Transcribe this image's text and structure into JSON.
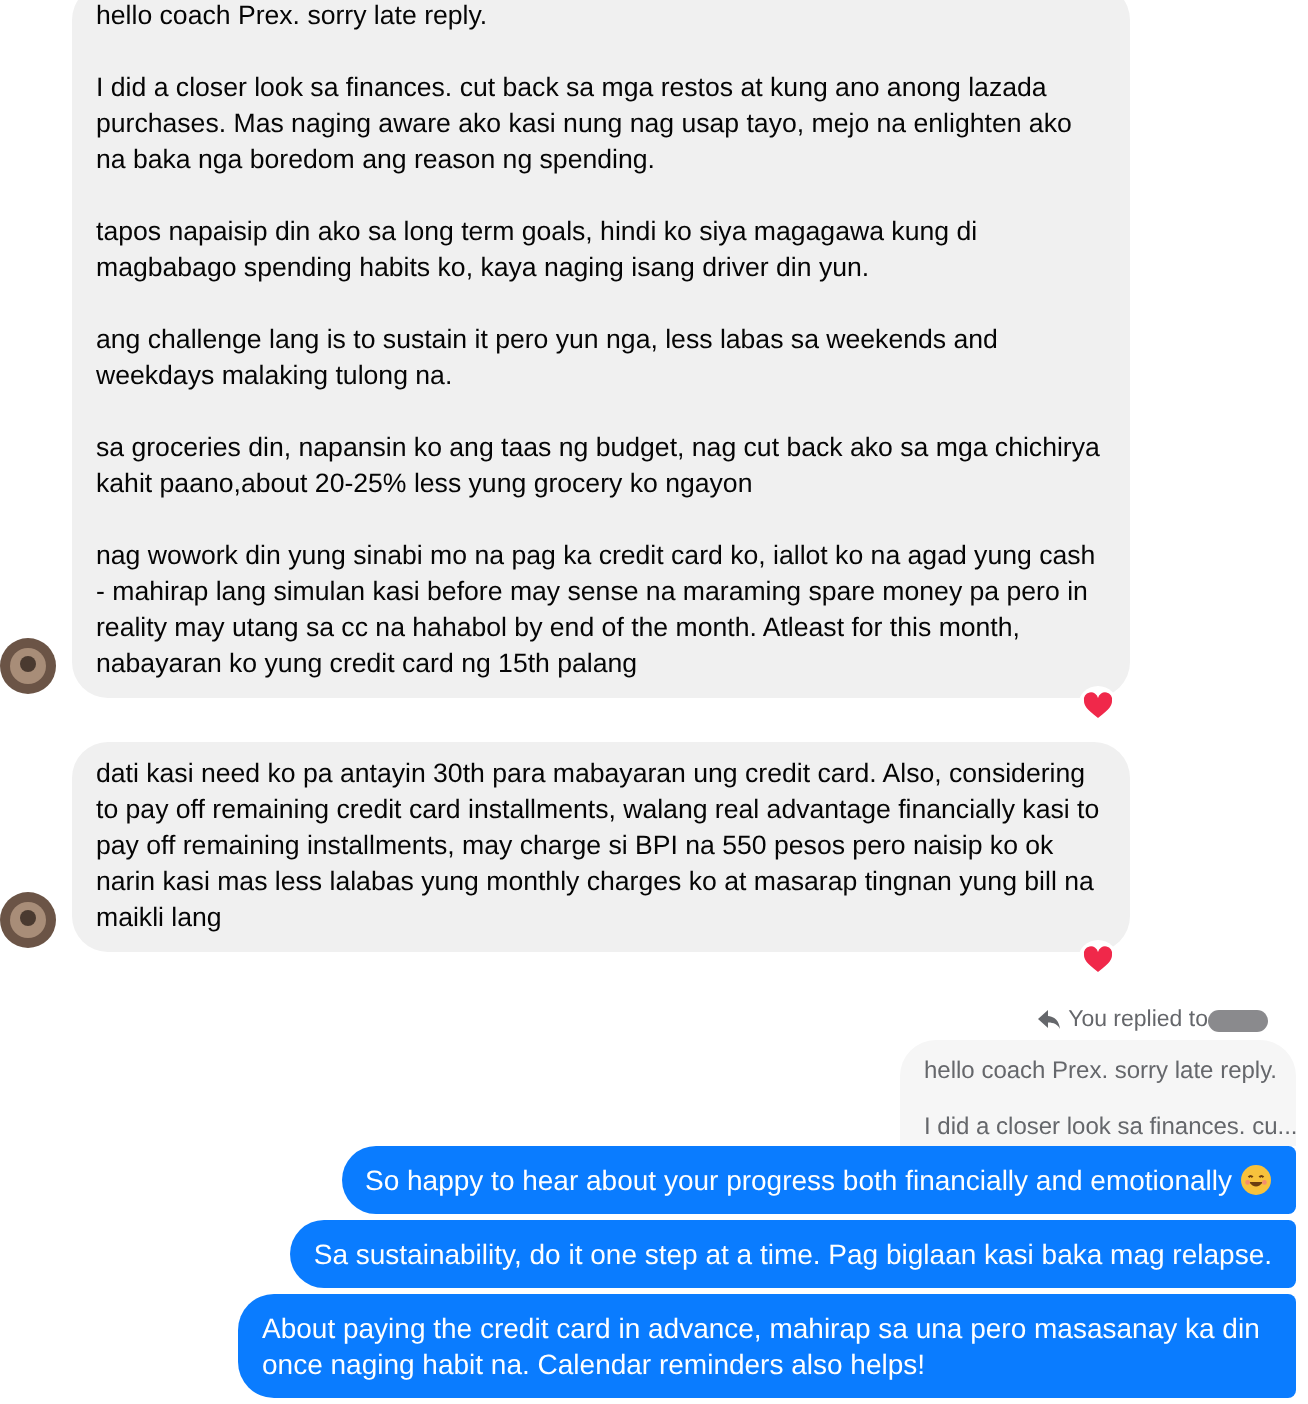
{
  "messages": [
    {
      "kind": "received",
      "show_avatar": true,
      "reacted": true,
      "paragraphs": [
        "hello coach Prex. sorry late reply.",
        "I did a closer look sa finances. cut back sa mga restos at kung ano anong lazada purchases. Mas naging aware ako kasi nung nag usap tayo, mejo na enlighten ako na baka nga boredom ang reason ng spending.",
        "tapos napaisip din ako sa long term goals, hindi ko siya magagawa kung di magbabago spending habits ko, kaya naging isang driver din yun.",
        "ang challenge lang is to sustain it pero yun nga, less labas sa weekends and weekdays malaking tulong na.",
        "sa groceries din, napansin ko ang taas ng budget, nag cut back ako sa mga chichirya kahit paano,about 20-25% less yung grocery ko ngayon",
        "nag wowork din yung sinabi mo na pag ka credit card ko, iallot ko na agad yung cash - mahirap lang simulan kasi before may sense na maraming spare money pa pero in reality may utang sa cc na hahabol by end of the month. Atleast for this month, nabayaran ko yung credit card ng 15th palang"
      ]
    },
    {
      "kind": "received",
      "show_avatar": true,
      "reacted": true,
      "paragraphs": [
        "dati kasi need ko pa antayin 30th para mabayaran ung credit card. Also, considering to pay off remaining credit card installments, walang real advantage financially kasi to pay off remaining installments, may charge si BPI na 550 pesos pero naisip ko ok narin kasi mas less lalabas yung monthly charges ko at masarap tingnan yung bill na maikli lang"
      ]
    },
    {
      "kind": "reply",
      "label": "You replied to",
      "quote_lines": [
        "hello coach Prex. sorry late reply.",
        "I did a closer look sa finances. cu..."
      ]
    },
    {
      "kind": "sent",
      "emoji": true,
      "text": "So happy to hear about your progress both financially and emotionally"
    },
    {
      "kind": "sent",
      "emoji": false,
      "text": "Sa sustainability, do it one step at a time. Pag biglaan kasi baka mag relapse."
    },
    {
      "kind": "sent",
      "emoji": false,
      "text": "About paying the credit card in advance, mahirap sa una pero masasanay ka din once naging habit na. Calendar reminders also helps!"
    }
  ]
}
